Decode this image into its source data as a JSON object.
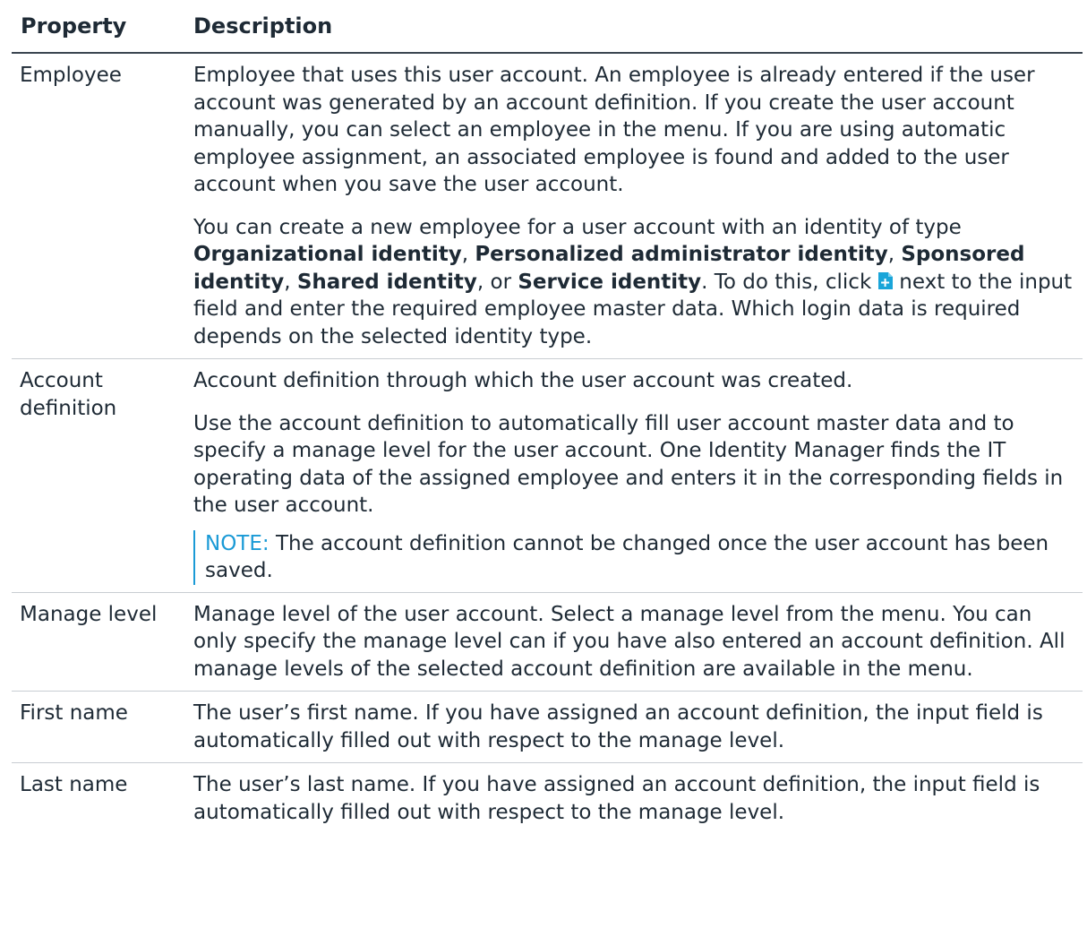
{
  "table": {
    "headers": {
      "property": "Property",
      "description": "Description"
    },
    "rows": {
      "employee": {
        "property": "Employee",
        "p1": "Employee that uses this user account. An employee is already entered if the user account was generated by an account definition. If you create the user account manually, you can select an employee in the menu. If you are using automatic employee assignment, an associated employee is found and added to the user account when you save the user account.",
        "p2": {
          "intro": "You can create a new employee for a user account with an identity of type ",
          "id1": "Organizational identity",
          "sep1": ", ",
          "id2": "Personalized administrator identity",
          "sep2": ", ",
          "id3": "Sponsored identity",
          "sep3": ", ",
          "id4": "Shared identity",
          "sep4": ", or ",
          "id5": "Service identity",
          "mid": ". To do this, click",
          "icon": "add-document-icon",
          "tail": "next to the input field and enter the required employee master data. Which login data is required depends on the selected identity type."
        }
      },
      "account_definition": {
        "property": "Account definition",
        "p1": "Account definition through which the user account was created.",
        "p2": "Use the account definition to automatically fill user account master data and to specify a manage level for the user account. One Identity Manager finds the IT operating data of the assigned employee and enters it in the corresponding fields in the user account.",
        "note_label": "NOTE:",
        "note_text": " The account definition cannot be changed once the user account has been saved."
      },
      "manage_level": {
        "property": "Manage level",
        "p1": "Manage level of the user account. Select a manage level from the menu. You can only specify the manage level can if you have also entered an account definition. All manage levels of the selected account definition are available in the menu."
      },
      "first_name": {
        "property": "First name",
        "p1": "The user’s first name. If you have assigned an account definition, the input field is automatically filled out with respect to the manage level."
      },
      "last_name": {
        "property": "Last name",
        "p1": "The user’s last name. If you have assigned an account definition, the input field is automatically filled out with respect to the manage level."
      }
    }
  },
  "colors": {
    "text": "#1e2a35",
    "note_accent": "#1a9ad6",
    "icon_accent": "#1aa5d9"
  }
}
